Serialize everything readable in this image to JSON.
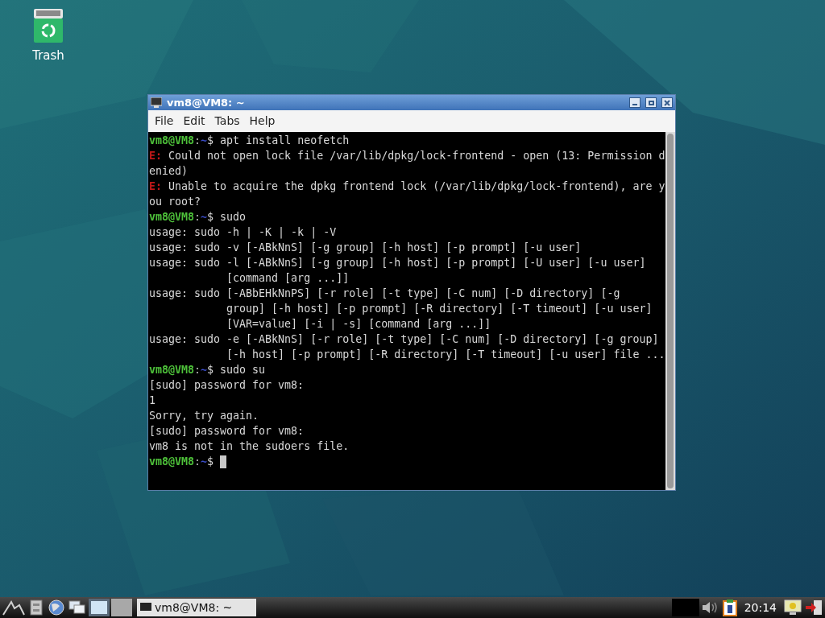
{
  "desktop": {
    "icons": [
      {
        "label": "Trash"
      }
    ]
  },
  "window": {
    "title": "vm8@VM8: ~",
    "menu": [
      "File",
      "Edit",
      "Tabs",
      "Help"
    ],
    "terminal": {
      "lines": [
        {
          "kind": "prompt",
          "host": "vm8@VM8",
          "sep": ":",
          "dir": "~",
          "command": "$ apt install neofetch"
        },
        {
          "kind": "error",
          "tag": "E:",
          "text": "Could not open lock file /var/lib/dpkg/lock-frontend - open (13: Permission d"
        },
        {
          "kind": "text",
          "text": "enied)"
        },
        {
          "kind": "error",
          "tag": "E:",
          "text": "Unable to acquire the dpkg frontend lock (/var/lib/dpkg/lock-frontend), are y"
        },
        {
          "kind": "text",
          "text": "ou root?"
        },
        {
          "kind": "prompt",
          "host": "vm8@VM8",
          "sep": ":",
          "dir": "~",
          "command": "$ sudo"
        },
        {
          "kind": "text",
          "text": "usage: sudo -h | -K | -k | -V"
        },
        {
          "kind": "text",
          "text": "usage: sudo -v [-ABkNnS] [-g group] [-h host] [-p prompt] [-u user]"
        },
        {
          "kind": "text",
          "text": "usage: sudo -l [-ABkNnS] [-g group] [-h host] [-p prompt] [-U user] [-u user]"
        },
        {
          "kind": "text",
          "text": "            [command [arg ...]]"
        },
        {
          "kind": "text",
          "text": "usage: sudo [-ABbEHkNnPS] [-r role] [-t type] [-C num] [-D directory] [-g"
        },
        {
          "kind": "text",
          "text": "            group] [-h host] [-p prompt] [-R directory] [-T timeout] [-u user]"
        },
        {
          "kind": "text",
          "text": "            [VAR=value] [-i | -s] [command [arg ...]]"
        },
        {
          "kind": "text",
          "text": "usage: sudo -e [-ABkNnS] [-r role] [-t type] [-C num] [-D directory] [-g group]"
        },
        {
          "kind": "text",
          "text": "            [-h host] [-p prompt] [-R directory] [-T timeout] [-u user] file ..."
        },
        {
          "kind": "prompt",
          "host": "vm8@VM8",
          "sep": ":",
          "dir": "~",
          "command": "$ sudo su"
        },
        {
          "kind": "text",
          "text": "[sudo] password for vm8:"
        },
        {
          "kind": "text",
          "text": "1"
        },
        {
          "kind": "text",
          "text": "Sorry, try again."
        },
        {
          "kind": "text",
          "text": "[sudo] password for vm8:"
        },
        {
          "kind": "text",
          "text": "vm8 is not in the sudoers file."
        },
        {
          "kind": "prompt",
          "host": "vm8@VM8",
          "sep": ":",
          "dir": "~",
          "command": "$",
          "cursor": true
        }
      ]
    }
  },
  "taskbar": {
    "tasks": [
      {
        "label": "vm8@VM8: ~",
        "selected": true
      }
    ],
    "clock": "20:14"
  }
}
